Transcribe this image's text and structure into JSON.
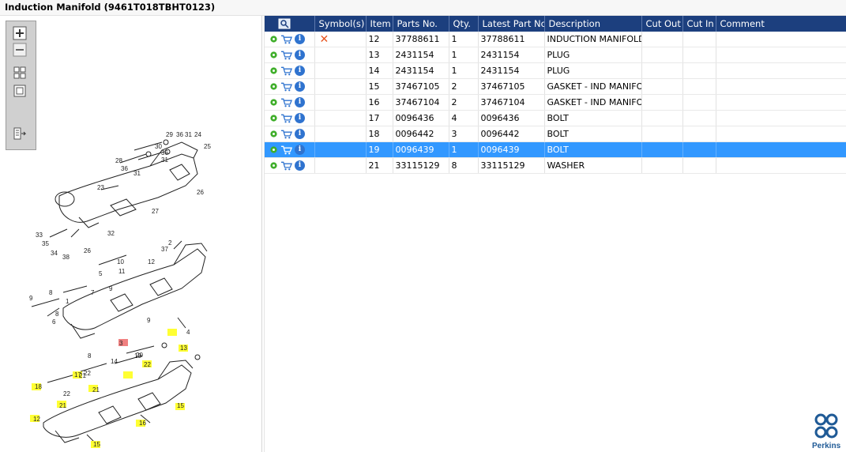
{
  "window": {
    "title": "Induction Manifold (9461T018TBHT0123)"
  },
  "toolbar": [
    {
      "name": "zoom-in-icon"
    },
    {
      "name": "zoom-out-icon"
    },
    {
      "name": "fit-all-icon"
    },
    {
      "name": "fit-window-icon"
    },
    {
      "name": "export-icon"
    }
  ],
  "table": {
    "columns": [
      "",
      "Symbol(s)",
      "Item",
      "Parts No.",
      "Qty.",
      "Latest Part No.",
      "Description",
      "Cut Out",
      "Cut In",
      "Comment"
    ],
    "rows": [
      {
        "symbol": "x",
        "item": "12",
        "part_no": "37788611",
        "qty": "1",
        "latest": "37788611",
        "desc": "INDUCTION MANIFOLD",
        "cut_out": "",
        "cut_in": "",
        "comment": ""
      },
      {
        "symbol": "",
        "item": "13",
        "part_no": "2431154",
        "qty": "1",
        "latest": "2431154",
        "desc": "PLUG",
        "cut_out": "",
        "cut_in": "",
        "comment": ""
      },
      {
        "symbol": "",
        "item": "14",
        "part_no": "2431154",
        "qty": "1",
        "latest": "2431154",
        "desc": "PLUG",
        "cut_out": "",
        "cut_in": "",
        "comment": ""
      },
      {
        "symbol": "",
        "item": "15",
        "part_no": "37467105",
        "qty": "2",
        "latest": "37467105",
        "desc": "GASKET - IND MANIFOLD",
        "cut_out": "",
        "cut_in": "",
        "comment": ""
      },
      {
        "symbol": "",
        "item": "16",
        "part_no": "37467104",
        "qty": "2",
        "latest": "37467104",
        "desc": "GASKET - IND MANIFOLD",
        "cut_out": "",
        "cut_in": "",
        "comment": ""
      },
      {
        "symbol": "",
        "item": "17",
        "part_no": "0096436",
        "qty": "4",
        "latest": "0096436",
        "desc": "BOLT",
        "cut_out": "",
        "cut_in": "",
        "comment": ""
      },
      {
        "symbol": "",
        "item": "18",
        "part_no": "0096442",
        "qty": "3",
        "latest": "0096442",
        "desc": "BOLT",
        "cut_out": "",
        "cut_in": "",
        "comment": ""
      },
      {
        "symbol": "",
        "item": "19",
        "part_no": "0096439",
        "qty": "1",
        "latest": "0096439",
        "desc": "BOLT",
        "cut_out": "",
        "cut_in": "",
        "comment": "",
        "selected": true
      },
      {
        "symbol": "",
        "item": "21",
        "part_no": "33115129",
        "qty": "8",
        "latest": "33115129",
        "desc": "WASHER",
        "cut_out": "",
        "cut_in": "",
        "comment": ""
      }
    ]
  },
  "diagram": {
    "labels": [
      "29",
      "36",
      "31",
      "24",
      "25",
      "30",
      "36",
      "31",
      "28",
      "36",
      "31",
      "23",
      "27",
      "26",
      "33",
      "35",
      "34",
      "38",
      "26",
      "32",
      "37",
      "2",
      "10",
      "5",
      "11",
      "12",
      "9",
      "8",
      "1",
      "7",
      "9",
      "8",
      "6",
      "9",
      "8",
      "4",
      "3",
      "13",
      "19",
      "14",
      "22",
      "20",
      "21",
      "22",
      "17",
      "21",
      "18",
      "22",
      "21",
      "16",
      "15",
      "12",
      "15"
    ]
  },
  "brand": {
    "name": "Perkins"
  },
  "colors": {
    "header": "#1c3f7e",
    "selected": "#3298ff",
    "highlight": "#ffff33",
    "highlight_selected": "#f08080"
  }
}
